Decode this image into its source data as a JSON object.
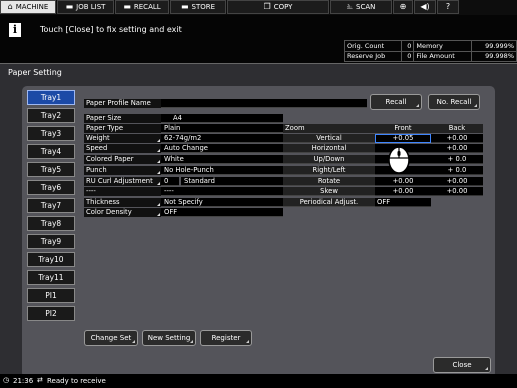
{
  "tabs": [
    {
      "label": "MACHINE",
      "icon": "home-icon",
      "active": true
    },
    {
      "label": "JOB LIST",
      "icon": "printer-icon"
    },
    {
      "label": "RECALL",
      "icon": "printer-icon"
    },
    {
      "label": "STORE",
      "icon": "printer-icon"
    },
    {
      "label": "COPY",
      "icon": "copy-icon"
    },
    {
      "label": "SCAN",
      "icon": "scan-icon"
    }
  ],
  "message": "Touch [Close] to fix setting and exit",
  "status": {
    "orig_count_label": "Orig. Count",
    "orig_count": "0",
    "memory_label": "Memory",
    "memory": "99.999%",
    "reserve_job_label": "Reserve Job",
    "reserve_job": "0",
    "file_amount_label": "File Amount",
    "file_amount": "99.998%"
  },
  "window_title": "Paper Setting",
  "trays": [
    "Tray1",
    "Tray2",
    "Tray3",
    "Tray4",
    "Tray5",
    "Tray6",
    "Tray7",
    "Tray8",
    "Tray9",
    "Tray10",
    "Tray11",
    "PI1",
    "PI2"
  ],
  "profile": {
    "label": "Paper Profile Name",
    "value": "",
    "recall": "Recall",
    "no_recall": "No. Recall"
  },
  "size": {
    "label": "Paper Size",
    "value": "A4"
  },
  "type": {
    "label": "Paper Type",
    "value": "Plain"
  },
  "weight": {
    "label": "Weight",
    "value": "62-74g/m2"
  },
  "speed": {
    "label": "Speed",
    "value": "Auto Change"
  },
  "colored": {
    "label": "Colored Paper",
    "value": "White"
  },
  "punch": {
    "label": "Punch",
    "value": "No Hole-Punch"
  },
  "ru": {
    "label": "RU Curl Adjustment",
    "num": "0",
    "value": "Standard"
  },
  "dash": {
    "label": "----",
    "value": "----"
  },
  "thickness": {
    "label": "Thickness",
    "value": "Not Specify"
  },
  "density": {
    "label": "Color Density",
    "value": "OFF"
  },
  "zoom": {
    "label": "Zoom",
    "front": "Front",
    "back": "Back",
    "rows": [
      {
        "name": "Vertical",
        "front": "+0.05",
        "back": "+0.00"
      },
      {
        "name": "Horizontal",
        "front": "",
        "back": "+0.00"
      },
      {
        "name": "Up/Down",
        "front": "",
        "back": "+ 0.0"
      },
      {
        "name": "Right/Left",
        "front": "",
        "back": "+ 0.0"
      },
      {
        "name": "Rotate",
        "front": "+0.00",
        "back": "+0.00"
      },
      {
        "name": "Skew",
        "front": "+0.00",
        "back": "+0.00"
      }
    ],
    "periodical_label": "Periodical Adjust.",
    "periodical_value": "OFF"
  },
  "buttons": {
    "change_set": "Change Set",
    "new_setting": "New Setting",
    "register": "Register",
    "close": "Close"
  },
  "time": "21:36",
  "ready": "Ready to receive"
}
